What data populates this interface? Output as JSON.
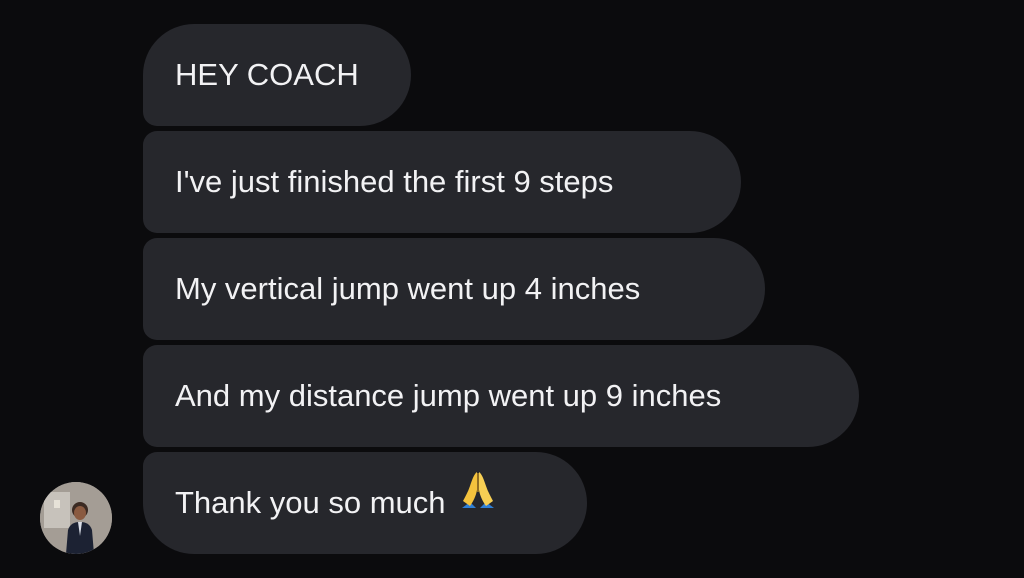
{
  "messages": [
    {
      "text": "HEY COACH"
    },
    {
      "text": "I've just finished the first 9 steps"
    },
    {
      "text": "My vertical jump went up 4 inches"
    },
    {
      "text": "And my distance jump went up 9 inches"
    },
    {
      "text": "Thank you so much",
      "emoji": "folded-hands-icon"
    }
  ],
  "sender": {
    "avatar": "user-avatar"
  },
  "colors": {
    "background": "#0b0b0d",
    "bubble": "#26272c",
    "text": "#f2f2f4"
  }
}
